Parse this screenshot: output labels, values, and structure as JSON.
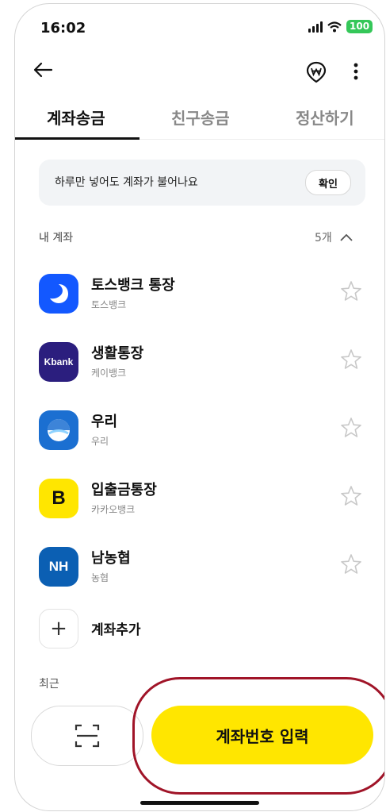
{
  "status": {
    "time": "16:02",
    "battery": "100"
  },
  "header": {
    "back": "back-icon",
    "won": "won-icon",
    "more": "more-icon"
  },
  "tabs": [
    {
      "label": "계좌송금",
      "active": true
    },
    {
      "label": "친구송금",
      "active": false
    },
    {
      "label": "정산하기",
      "active": false
    }
  ],
  "banner": {
    "text": "하루만 넣어도 계좌가 불어나요",
    "button": "확인"
  },
  "accounts_section": {
    "label": "내 계좌",
    "count": "5개"
  },
  "accounts": [
    {
      "name": "토스뱅크 통장",
      "bank": "토스뱅크",
      "color": "#1358ff"
    },
    {
      "name": "생활통장",
      "bank": "케이뱅크",
      "color": "#2b1e7e",
      "logo_text": "Kbank"
    },
    {
      "name": "우리",
      "bank": "우리",
      "color": "#1b6fd1"
    },
    {
      "name": "입출금통장",
      "bank": "카카오뱅크",
      "color": "#ffe600",
      "logo_text": "B"
    },
    {
      "name": "남농협",
      "bank": "농협",
      "color": "#0b5fb3",
      "logo_text": "NH"
    }
  ],
  "add_account": {
    "label": "계좌추가",
    "icon": "+"
  },
  "recent": {
    "label": "최근"
  },
  "actions": {
    "scan": "scan-icon",
    "enter": "계좌번호 입력"
  },
  "colors": {
    "accent": "#ffe600",
    "highlight": "#a01428"
  }
}
